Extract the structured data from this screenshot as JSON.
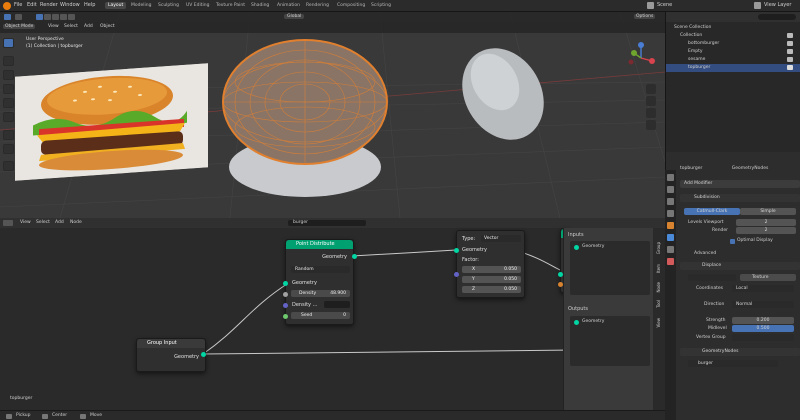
{
  "top_menu": {
    "items": [
      "File",
      "Edit",
      "Render",
      "Window",
      "Help"
    ]
  },
  "workspaces": [
    "Layout",
    "Modeling",
    "Sculpting",
    "UV Editing",
    "Texture Paint",
    "Shading",
    "Animation",
    "Rendering",
    "Compositing",
    "Scripting"
  ],
  "scene": {
    "label": "Scene"
  },
  "view_layer": {
    "label": "View Layer"
  },
  "viewport": {
    "mode": "Object Mode",
    "menus": [
      "View",
      "Select",
      "Add",
      "Object"
    ],
    "transform": "Global",
    "options": "Options",
    "info_line1": "User Perspective",
    "info_line2": "(1) Collection | topburger"
  },
  "outliner": {
    "items": [
      {
        "label": "Scene Collection",
        "indent": 0,
        "selected": false
      },
      {
        "label": "Collection",
        "indent": 1,
        "selected": false
      },
      {
        "label": "bottomburger",
        "indent": 2,
        "selected": false
      },
      {
        "label": "Empty",
        "indent": 2,
        "selected": false
      },
      {
        "label": "sesame",
        "indent": 2,
        "selected": false
      },
      {
        "label": "topburger",
        "indent": 2,
        "selected": true
      }
    ]
  },
  "properties": {
    "object": "topburger",
    "modifier_tab": "GeometryNodes",
    "add_modifier": "Add Modifier",
    "subdivision": {
      "name": "Subdivision",
      "mode_a": "Catmull-Clark",
      "mode_b": "Simple",
      "levels_label": "Levels Viewport",
      "levels_value": "2",
      "render_label": "Render",
      "render_value": "2",
      "optimal": "Optimal Display",
      "advanced": "Advanced"
    },
    "displace": {
      "name": "Displace",
      "texture_label": "Texture",
      "coordinates_label": "Coordinates",
      "coordinates_value": "Local",
      "direction_label": "Direction",
      "direction_value": "Normal",
      "strength_label": "Strength",
      "strength_value": "0.200",
      "midlevel_label": "Midlevel",
      "midlevel_value": "0.500",
      "vertex_group_label": "Vertex Group"
    },
    "geonodes": {
      "name": "GeometryNodes",
      "tree": "burger"
    }
  },
  "node_editor": {
    "menus": [
      "View",
      "Select",
      "Add",
      "Node"
    ],
    "tree_name": "burger",
    "point_distribute": {
      "title": "Point Distribute",
      "out_geometry": "Geometry",
      "method": "Random",
      "in_geometry": "Geometry",
      "density_label": "Density",
      "density_value": "48.900",
      "density_attr": "Density ...",
      "seed_label": "Seed",
      "seed_value": "0"
    },
    "vector_node": {
      "type_label": "Type:",
      "type_value": "Vector",
      "out_geometry": "Geometry",
      "factor_label": "Factor:",
      "x_label": "X",
      "x_value": "0.050",
      "y_label": "Y",
      "y_value": "0.050",
      "z_label": "Z",
      "z_value": "0.050"
    },
    "group_input": {
      "title": "Group Input",
      "out_geometry": "Geometry"
    },
    "sidebar": {
      "inputs_title": "Inputs",
      "inputs_item": "Geometry",
      "outputs_title": "Outputs",
      "outputs_item": "Geometry",
      "tabs": [
        "Group",
        "Item",
        "Node",
        "Tool",
        "View"
      ]
    },
    "footer_label": "topburger",
    "partial_sockets": [
      "Ge",
      "Ol"
    ]
  },
  "statusbar": {
    "items": [
      "Pickup",
      "Center",
      "Move"
    ]
  },
  "colors": {
    "accent": "#4772b3",
    "pd_header": "#00a071",
    "geometry_socket": "#00d6a3",
    "vector_socket": "#6363c7",
    "float_socket": "#a1a1a1",
    "burger_wire": "#e0802f"
  }
}
